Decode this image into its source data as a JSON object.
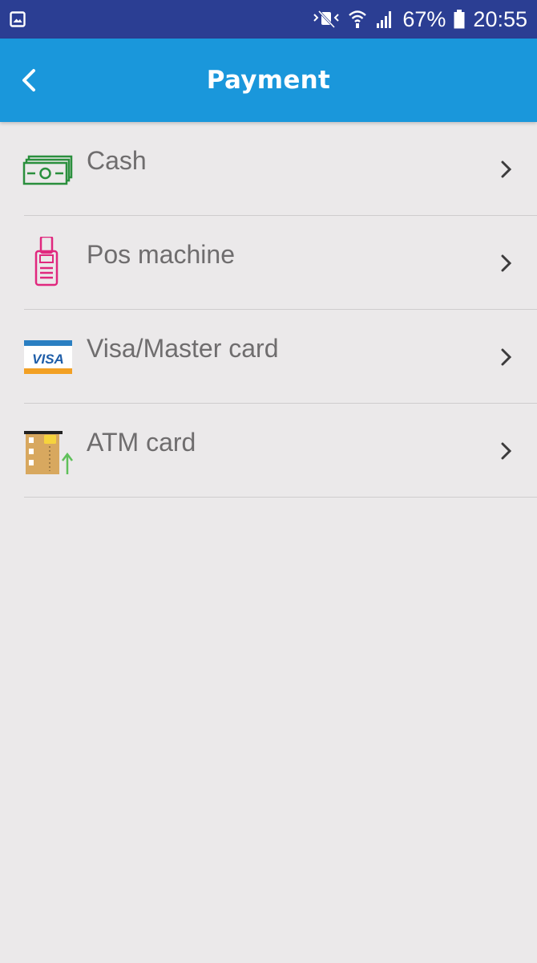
{
  "status_bar": {
    "battery_percent": "67%",
    "time": "20:55",
    "icons": [
      "gallery-icon",
      "mute-icon",
      "wifi-icon",
      "signal-icon",
      "battery-icon"
    ]
  },
  "app_bar": {
    "title": "Payment",
    "back_icon": "chevron-left-icon",
    "color": "#1a97db"
  },
  "payment_methods": [
    {
      "label": "Cash",
      "icon": "cash-icon"
    },
    {
      "label": "Pos machine",
      "icon": "pos-machine-icon"
    },
    {
      "label": "Visa/Master card",
      "icon": "visa-card-icon"
    },
    {
      "label": "ATM card",
      "icon": "atm-card-icon"
    }
  ],
  "colors": {
    "status_bar": "#2b3e93",
    "background": "#ebe9ea",
    "text": "#6f6d6e"
  }
}
